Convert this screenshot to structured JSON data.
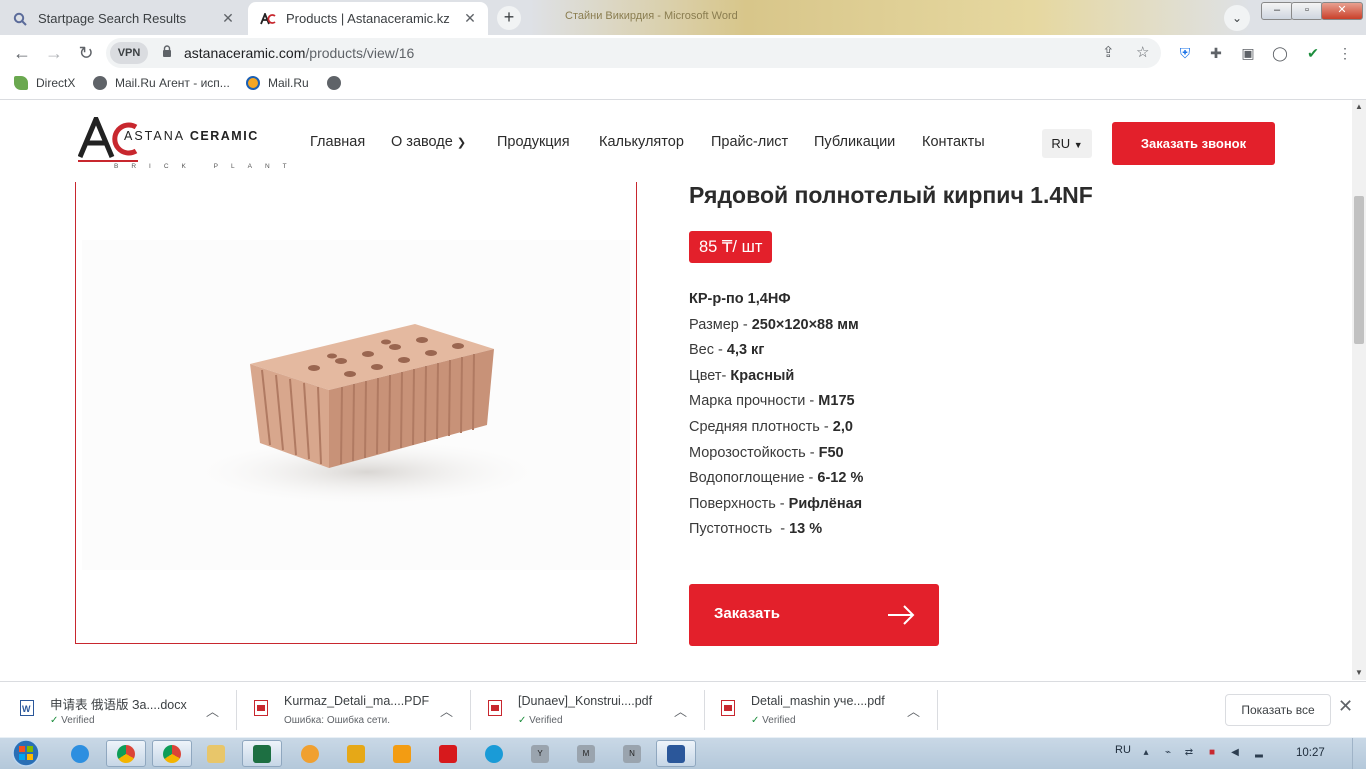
{
  "browser": {
    "tabs": [
      {
        "title": "Startpage Search Results",
        "active": false
      },
      {
        "title": "Products | Astanaceramic.kz",
        "active": true
      }
    ],
    "background_window_title": "Стайни Викирдия - Microsoft Word",
    "url_host": "astanaceramic.com",
    "url_path": "/products/view/16",
    "vpn_label": "VPN",
    "bookmarks": [
      {
        "label": "DirectX"
      },
      {
        "label": "Mail.Ru Агент - исп..."
      },
      {
        "label": "Mail.Ru"
      }
    ]
  },
  "site": {
    "logo_brand": "ASTANA",
    "logo_brand_bold": "CERAMIC",
    "logo_sub": "BRICK PLANT",
    "nav": [
      "Главная",
      "О заводе",
      "Продукция",
      "Калькулятор",
      "Прайс-лист",
      "Публикации",
      "Контакты"
    ],
    "language": "RU",
    "call_button": "Заказать звонок"
  },
  "product": {
    "title": "Рядовой полнотелый кирпич 1.4NF",
    "price": "85 ₸/ шт",
    "code": "КР-р-по 1,4НФ",
    "specs": [
      {
        "label": "Размер - ",
        "value": "250×120×88 мм"
      },
      {
        "label": "Вес - ",
        "value": "4,3 кг"
      },
      {
        "label": "Цвет- ",
        "value": "Красный"
      },
      {
        "label": "Марка прочности - ",
        "value": "М175"
      },
      {
        "label": "Средняя плотность - ",
        "value": "2,0"
      },
      {
        "label": "Морозостойкость - ",
        "value": "F50"
      },
      {
        "label": "Водопоглощение - ",
        "value": "6-12 %"
      },
      {
        "label": "Поверхность - ",
        "value": "Рифлёная"
      },
      {
        "label": "Пустотность  - ",
        "value": "13 %"
      }
    ],
    "order_button": "Заказать"
  },
  "downloads": {
    "items": [
      {
        "name": "申请表 俄语版 За....docx",
        "status": "Verified",
        "type": "word"
      },
      {
        "name": "Kurmaz_Detali_ma....PDF",
        "status": "Ошибка: Ошибка сети.",
        "type": "pdf"
      },
      {
        "name": "[Dunaev]_Konstrui....pdf",
        "status": "Verified",
        "type": "pdf"
      },
      {
        "name": "Detali_mashin уче....pdf",
        "status": "Verified",
        "type": "pdf"
      }
    ],
    "show_all": "Показать все"
  },
  "taskbar": {
    "language": "RU",
    "time": "10:27"
  },
  "colors": {
    "accent": "#e3202b",
    "tabstrip": "#dee1e6",
    "taskbar": "#b4c8da"
  }
}
